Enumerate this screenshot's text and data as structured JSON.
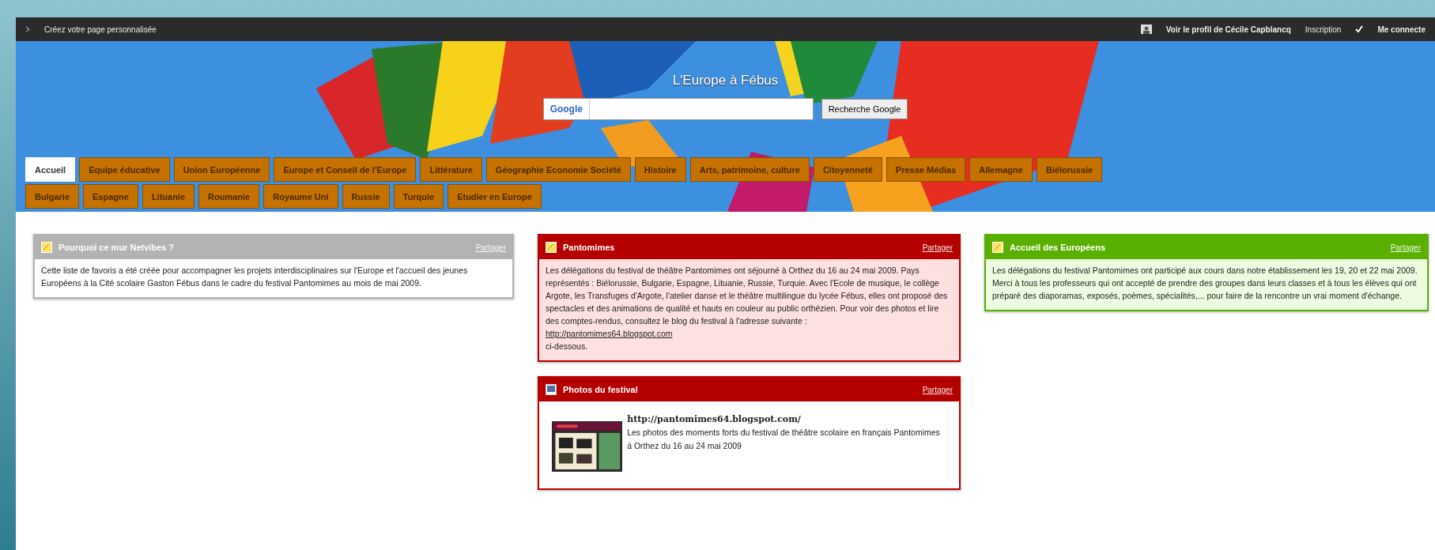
{
  "top_bar": {
    "create_link": "Créez votre page personnalisée",
    "profile_link": "Voir le profil de Cécile Capblancq",
    "signup_link": "Inscription",
    "login_link": "Me connecte"
  },
  "banner": {
    "title": "L'Europe à Fébus",
    "search": {
      "logo": "Google",
      "button": "Recherche Google"
    }
  },
  "tabs": [
    [
      {
        "label": "Accueil",
        "selected": true
      },
      {
        "label": "Equipe éducative",
        "selected": false
      },
      {
        "label": "Union Européenne",
        "selected": false
      },
      {
        "label": "Europe et Conseil de l'Europe",
        "selected": false
      },
      {
        "label": "Littérature",
        "selected": false
      },
      {
        "label": "Géographie Economie Société",
        "selected": false
      },
      {
        "label": "Histoire",
        "selected": false
      },
      {
        "label": "Arts, patrimoine, culture",
        "selected": false
      },
      {
        "label": "Citoyenneté",
        "selected": false
      },
      {
        "label": "Presse Médias",
        "selected": false
      },
      {
        "label": "Allemagne",
        "selected": false
      },
      {
        "label": "Biélorussie",
        "selected": false
      }
    ],
    [
      {
        "label": "Bulgarie",
        "selected": false
      },
      {
        "label": "Espagne",
        "selected": false
      },
      {
        "label": "Lituanie",
        "selected": false
      },
      {
        "label": "Roumanie",
        "selected": false
      },
      {
        "label": "Royaume Uni",
        "selected": false
      },
      {
        "label": "Russie",
        "selected": false
      },
      {
        "label": "Turquie",
        "selected": false
      },
      {
        "label": "Etudier en Europe",
        "selected": false
      }
    ]
  ],
  "columns": [
    [
      {
        "kind": "note",
        "color": "#b3b3b3",
        "title": "Pourquoi ce mur Netvibes ?",
        "share": "Partager",
        "body": [
          {
            "kind": "text",
            "text": "Cette liste de favoris a été créée pour accompagner les projets interdisciplinaires sur l'Europe et l'accueil des jeunes Européens à la Cité scolaire Gaston Fébus  dans le cadre du festival Pantomimes au mois de mai 2009."
          }
        ]
      }
    ],
    [
      {
        "kind": "note",
        "color": "#b50000",
        "title": "Pantomimes",
        "share": "Partager",
        "body": [
          {
            "kind": "text",
            "text": "Les délégations du festival de théâtre Pantomimes ont séjourné à Orthez du 16 au 24 mai 2009. Pays représentés : Biélorussie, Bulgarie, Espagne, Lituanie, Russie, Turquie. Avec l'Ecole de musique, le collège Argote, les Transfuges d'Argote, l'atelier danse  et le théâtre multilingue du lycée Fébus, elles ont proposé des spectacles et des animations de qualité et hauts en couleur au public orthézien. Pour voir des photos et lire des comptes-rendus, consultez le blog du festival à l'adresse suivante :"
          },
          {
            "kind": "link",
            "text": "http://pantomimes64.blogspot.com"
          },
          {
            "kind": "text",
            "text": "ci-dessous."
          }
        ]
      },
      {
        "kind": "feed",
        "color": "#b50000",
        "title": "Photos du festival",
        "share": "Partager",
        "link": "http://pantomimes64.blogspot.com/",
        "description": "Les photos des moments forts du festival de théâtre scolaire en français Pantomimes à Orthez du 16 au 24 mai 2009"
      }
    ],
    [
      {
        "kind": "note",
        "color": "#5ab000",
        "title": "Accueil des Européens",
        "share": "Partager",
        "body": [
          {
            "kind": "text",
            "text": "Les délégations du festival Pantomimes ont participé aux cours dans notre établissement les 19, 20 et 22 mai 2009."
          },
          {
            "kind": "text",
            "text": "Merci à tous les professeurs qui ont accepté de prendre des groupes dans leurs classes et à tous les élèves qui ont préparé des diaporamas, exposés, poèmes, spécialités,... pour faire de la rencontre un vrai moment d'échange."
          }
        ]
      }
    ]
  ]
}
